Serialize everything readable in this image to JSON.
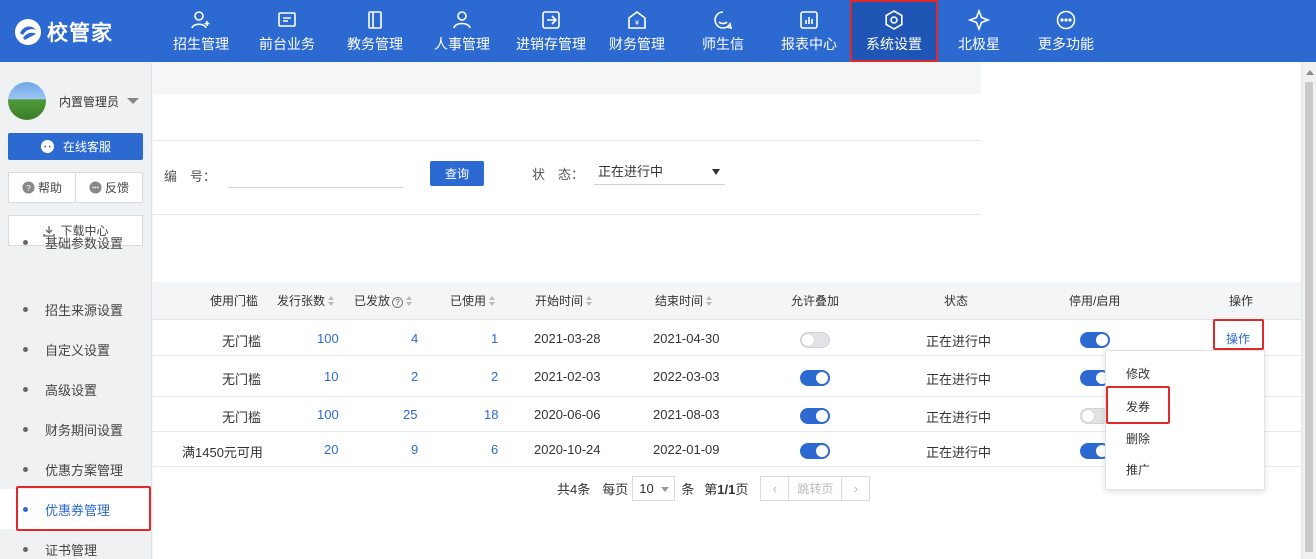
{
  "app": {
    "logo_text": "校管家"
  },
  "nav": {
    "items": [
      {
        "label": "招生管理",
        "icon": "user-plus-icon"
      },
      {
        "label": "前台业务",
        "icon": "monitor-icon"
      },
      {
        "label": "教务管理",
        "icon": "book-icon"
      },
      {
        "label": "人事管理",
        "icon": "person-icon"
      },
      {
        "label": "进销存管理",
        "icon": "inventory-icon"
      },
      {
        "label": "财务管理",
        "icon": "finance-icon"
      },
      {
        "label": "师生信",
        "icon": "message-icon"
      },
      {
        "label": "报表中心",
        "icon": "chart-icon"
      },
      {
        "label": "系统设置",
        "icon": "settings-icon"
      },
      {
        "label": "北极星",
        "icon": "star-icon"
      },
      {
        "label": "更多功能",
        "icon": "more-icon"
      }
    ],
    "active": "系统设置"
  },
  "sidebar": {
    "user_name": "内置管理员",
    "online_service": "在线客服",
    "help": "帮助",
    "feedback": "反馈",
    "download": "下载中心",
    "items": [
      {
        "label": "基础参数设置"
      },
      {
        "label": "招生来源设置"
      },
      {
        "label": "自定义设置"
      },
      {
        "label": "高级设置"
      },
      {
        "label": "财务期间设置"
      },
      {
        "label": "优惠方案管理"
      },
      {
        "label": "优惠券管理"
      },
      {
        "label": "证书管理"
      }
    ],
    "active": "优惠券管理"
  },
  "filters": {
    "number_label": "编　号：",
    "number_value": "",
    "query_button": "查询",
    "status_label": "状　态：",
    "status_value": "正在进行中"
  },
  "table": {
    "headers": {
      "threshold": "使用门槛",
      "issued_count": "发行张数",
      "distributed": "已发放",
      "used": "已使用",
      "start": "开始时间",
      "end": "结束时间",
      "stackable": "允许叠加",
      "status": "状态",
      "enabled": "停用/启用",
      "action": "操作"
    },
    "rows": [
      {
        "threshold": "无门槛",
        "issued_count": "100",
        "distributed": "4",
        "used": "1",
        "start": "2021-03-28",
        "end": "2021-04-30",
        "stackable": false,
        "status": "正在进行中",
        "enabled": true,
        "action": "操作"
      },
      {
        "threshold": "无门槛",
        "issued_count": "10",
        "distributed": "2",
        "used": "2",
        "start": "2021-02-03",
        "end": "2022-03-03",
        "stackable": true,
        "status": "正在进行中",
        "enabled": true
      },
      {
        "threshold": "无门槛",
        "issued_count": "100",
        "distributed": "25",
        "used": "18",
        "start": "2020-06-06",
        "end": "2021-08-03",
        "stackable": true,
        "status": "正在进行中",
        "enabled": false
      },
      {
        "threshold": "满1450元可用",
        "issued_count": "20",
        "distributed": "9",
        "used": "6",
        "start": "2020-10-24",
        "end": "2022-01-09",
        "stackable": true,
        "status": "正在进行中",
        "enabled": true
      }
    ]
  },
  "action_menu": {
    "items": [
      "修改",
      "发券",
      "删除",
      "推广"
    ]
  },
  "pagination": {
    "total": "共4条",
    "per_page_label": "每页",
    "per_page": "10",
    "unit": "条",
    "page_info_prefix": "第",
    "page_info_current": "1/1",
    "page_info_suffix": "页",
    "jump": "跳转页"
  },
  "colors": {
    "brand": "#2c6ad1",
    "highlight": "#e02a2a"
  }
}
